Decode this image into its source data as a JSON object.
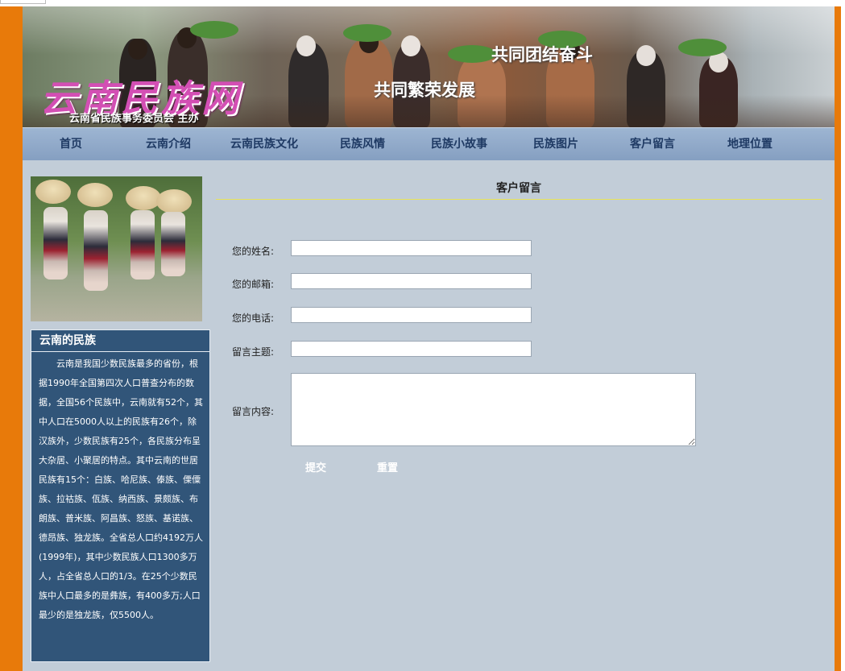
{
  "banner": {
    "logo_text": "云南民族网",
    "subtitle": "云南省民族事务委员会  主办",
    "slogan_1": "共同团结奋斗",
    "slogan_2": "共同繁荣发展"
  },
  "nav": {
    "items": [
      {
        "label": "首页"
      },
      {
        "label": "云南介绍"
      },
      {
        "label": "云南民族文化"
      },
      {
        "label": "民族风情"
      },
      {
        "label": "民族小故事"
      },
      {
        "label": "民族图片"
      },
      {
        "label": "客户留言"
      },
      {
        "label": "地理位置"
      }
    ]
  },
  "sidebar": {
    "box_title": "云南的民族",
    "box_text": "云南是我国少数民族最多的省份，根据1990年全国第四次人口普查分布的数据，全国56个民族中，云南就有52个，其中人口在5000人以上的民族有26个，除汉族外，少数民族有25个，各民族分布呈大杂居、小聚居的特点。其中云南的世居民族有15个：白族、哈尼族、傣族、傈僳族、拉祜族、佤族、纳西族、景颇族、布朗族、普米族、阿昌族、怒族、基诺族、德昂族、独龙族。全省总人口约4192万人(1999年)，其中少数民族人口1300多万人，占全省总人口的1/3。在25个少数民族中人口最多的是彝族，有400多万;人口最少的是独龙族，仅5500人。"
  },
  "form": {
    "title": "客户留言",
    "name_label": "您的姓名:",
    "name_value": "",
    "email_label": "您的邮箱:",
    "email_value": "",
    "phone_label": "您的电话:",
    "phone_value": "",
    "subject_label": "留言主题:",
    "subject_value": "",
    "content_label": "留言内容:",
    "content_value": "",
    "submit_label": "提交",
    "reset_label": "重置"
  },
  "colors": {
    "page_border": "#e87a0a",
    "content_bg": "#c2cdd8",
    "nav_bg": "#8fa8c8",
    "nav_text": "#1f3a64",
    "sidebar_box_bg": "#315579",
    "title_underline": "#e7e35a"
  }
}
